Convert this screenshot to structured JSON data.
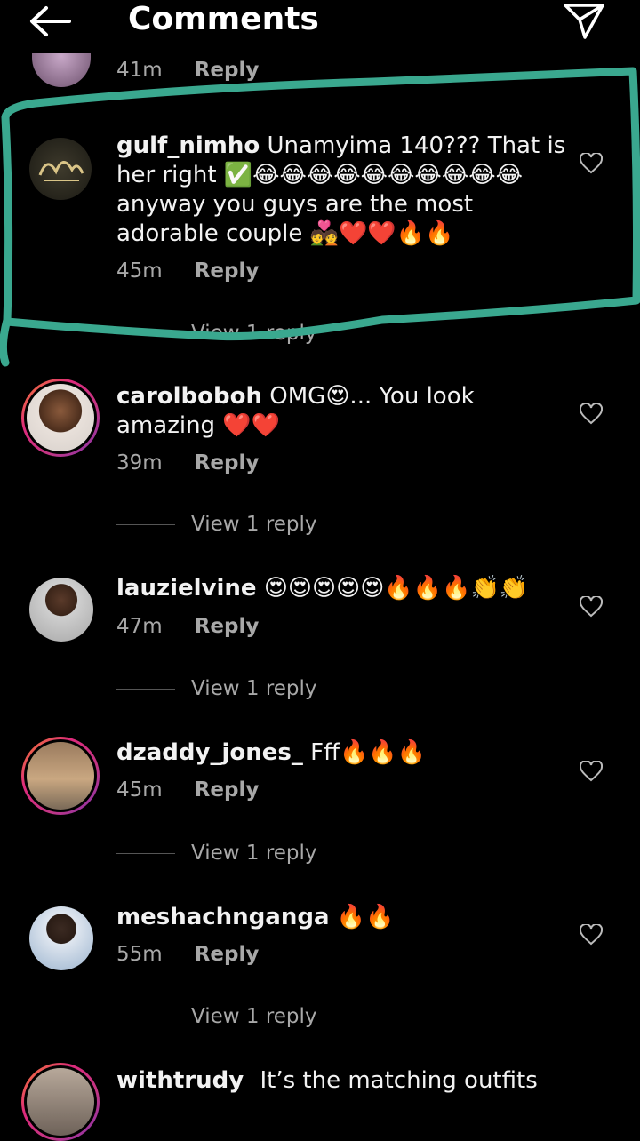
{
  "header": {
    "title": "Comments",
    "back_icon": "arrow-left-icon",
    "send_icon": "send-icon"
  },
  "comments": [
    {
      "time": "41m",
      "reply": "Reply"
    },
    {
      "username": "gulf_nimho",
      "text": "Unamyima 140??? That is her right ✅😂😂😂😂😂😂😂😂😂😂 anyway you guys are the most adorable couple 💑❤️❤️🔥🔥",
      "time": "45m",
      "reply": "Reply",
      "view_replies": "View 1 reply"
    },
    {
      "username": "carolboboh",
      "text": "OMG😍... You look amazing ❤️❤️",
      "time": "39m",
      "reply": "Reply",
      "view_replies": "View 1 reply"
    },
    {
      "username": "lauzielvine",
      "text": "😍😍😍😍😍🔥🔥🔥👏👏",
      "time": "47m",
      "reply": "Reply",
      "view_replies": "View 1 reply"
    },
    {
      "username": "dzaddy_jones_",
      "text": "Fff🔥🔥🔥",
      "time": "45m",
      "reply": "Reply",
      "view_replies": "View 1 reply"
    },
    {
      "username": "meshachnganga",
      "text": "🔥🔥",
      "time": "55m",
      "reply": "Reply",
      "view_replies": "View 1 reply"
    },
    {
      "username": "withtrudy",
      "text": "It’s the matching outfits"
    }
  ],
  "annotation_color": "#3aa88f"
}
